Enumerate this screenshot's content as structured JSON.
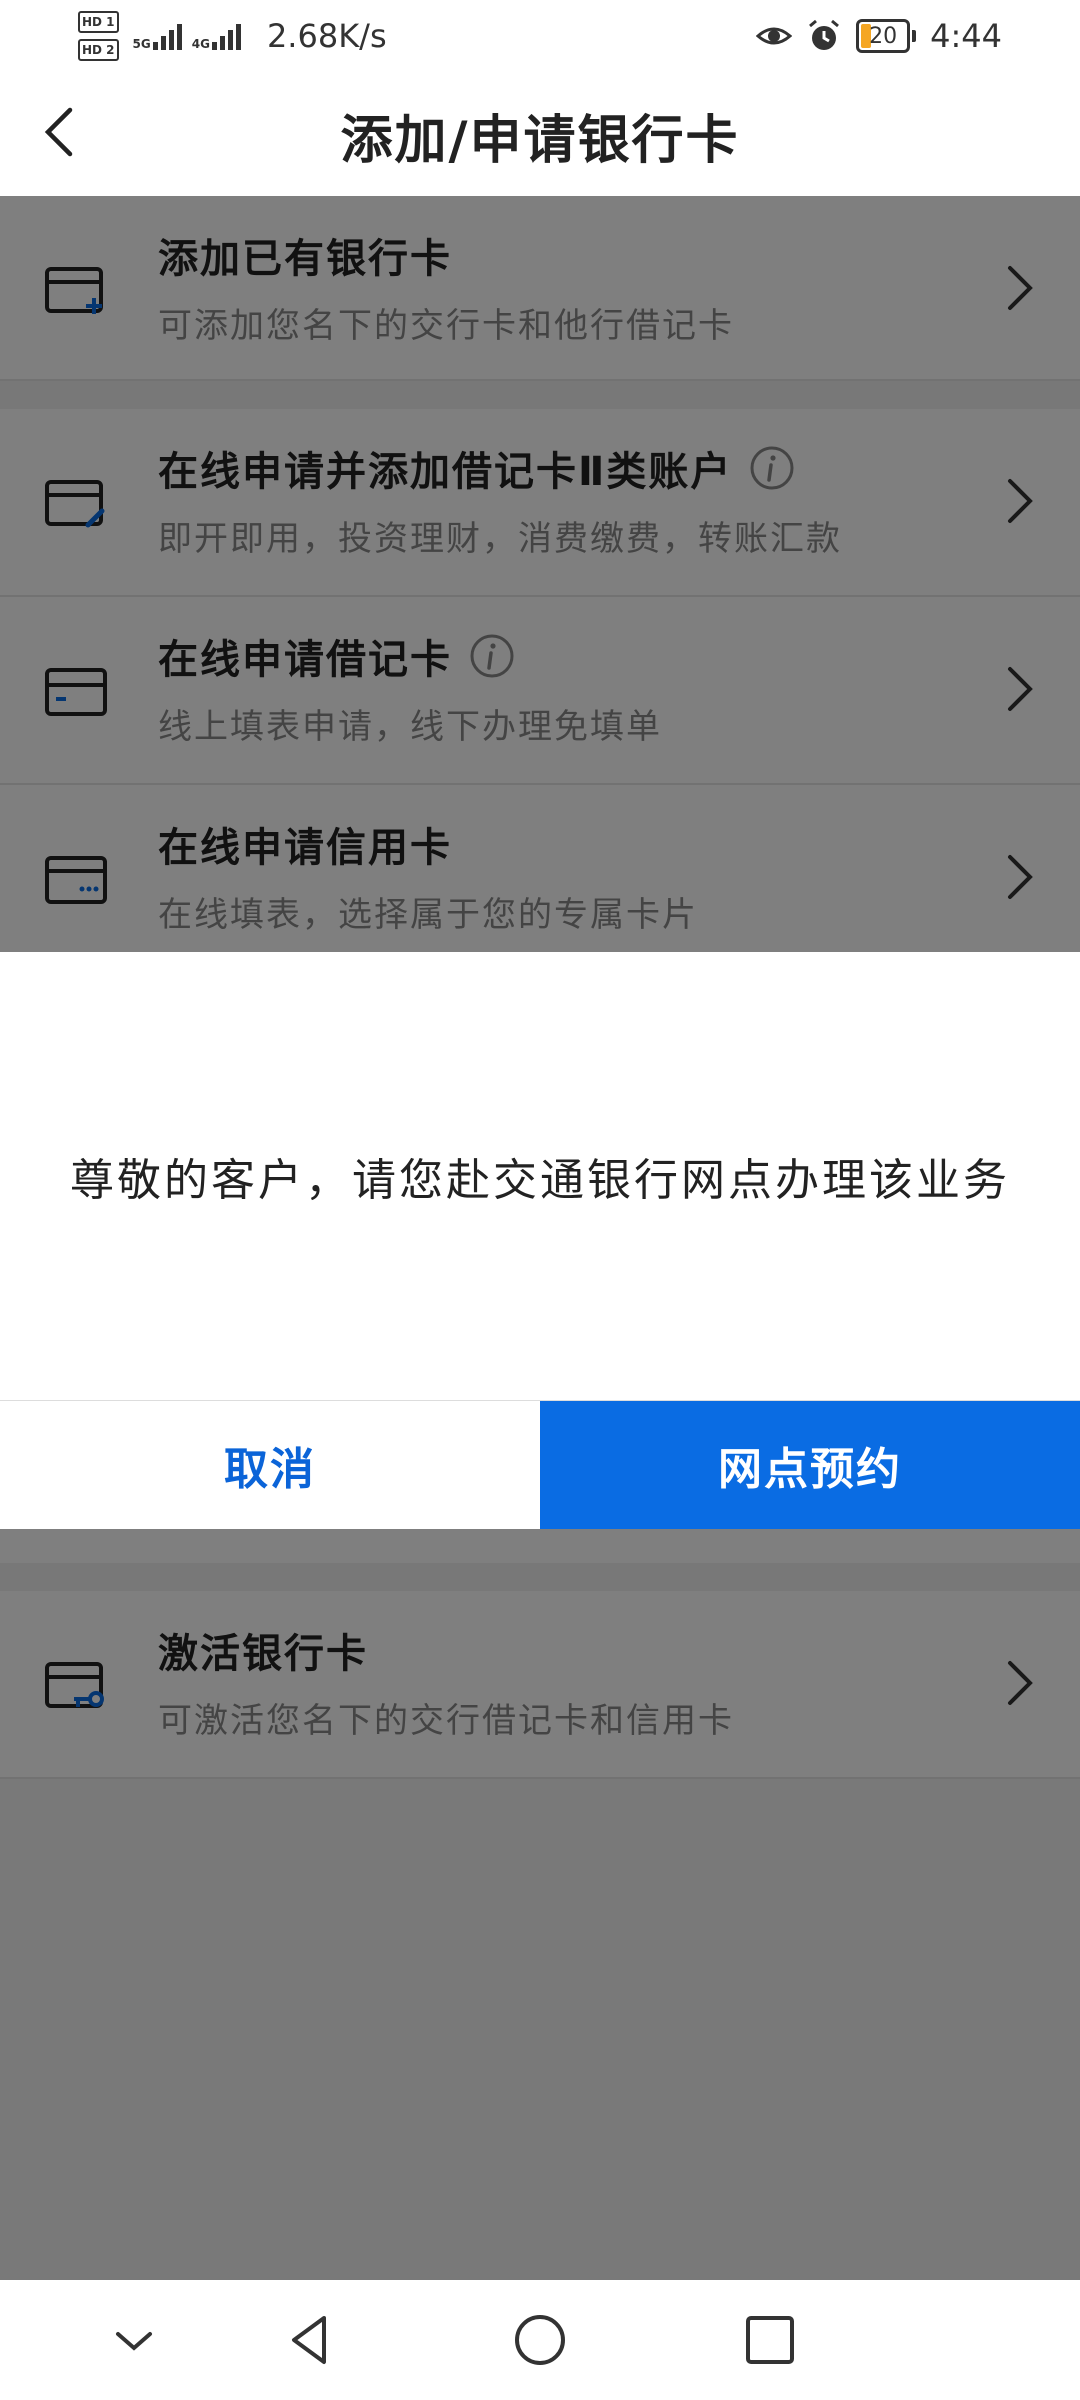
{
  "status_bar": {
    "hd1": "HD 1",
    "hd2": "HD 2",
    "sig1_label": "5G",
    "sig2_label": "4G",
    "speed": "2.68K/s",
    "battery": "20",
    "time": "4:44"
  },
  "header": {
    "title": "添加/申请银行卡"
  },
  "list": [
    {
      "title": "添加已有银行卡",
      "subtitle": "可添加您名下的交行卡和他行借记卡"
    },
    {
      "title": "在线申请并添加借记卡Ⅱ类账户",
      "subtitle": "即开即用，投资理财，消费缴费，转账汇款"
    },
    {
      "title": "在线申请借记卡",
      "subtitle": "线上填表申请，线下办理免填单"
    },
    {
      "title": "在线申请信用卡",
      "subtitle": "在线填表，选择属于您的专属卡片"
    },
    {
      "title": "激活银行卡",
      "subtitle": "可激活您名下的交行借记卡和信用卡"
    }
  ],
  "dialog": {
    "message": "尊敬的客户，请您赴交通银行网点办理该业务",
    "cancel": "取消",
    "confirm": "网点预约"
  },
  "colors": {
    "accent": "#0a6ce3",
    "link": "#0b64d8"
  }
}
